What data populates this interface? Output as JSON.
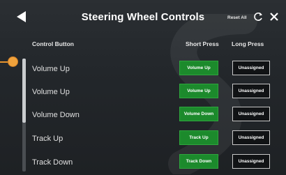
{
  "header": {
    "title": "Steering Wheel Controls",
    "reset_label": "Reset All"
  },
  "columns": {
    "control": "Control Button",
    "short": "Short Press",
    "long": "Long Press"
  },
  "rows": [
    {
      "label": "Volume Up",
      "short": "Volume Up",
      "long": "Unassigned"
    },
    {
      "label": "Volume Up",
      "short": "Volume Up",
      "long": "Unassigned"
    },
    {
      "label": "Volume Down",
      "short": "Volume Down",
      "long": "Unassigned"
    },
    {
      "label": "Track Up",
      "short": "Track Up",
      "long": "Unassigned"
    },
    {
      "label": "Track Down",
      "short": "Track Down",
      "long": "Unassigned"
    }
  ],
  "colors": {
    "assigned": "#1c8a2c",
    "unassigned": "#111315",
    "callout": "#f0a23c"
  },
  "icons": [
    "back-arrow-icon",
    "reset-icon",
    "close-icon"
  ]
}
